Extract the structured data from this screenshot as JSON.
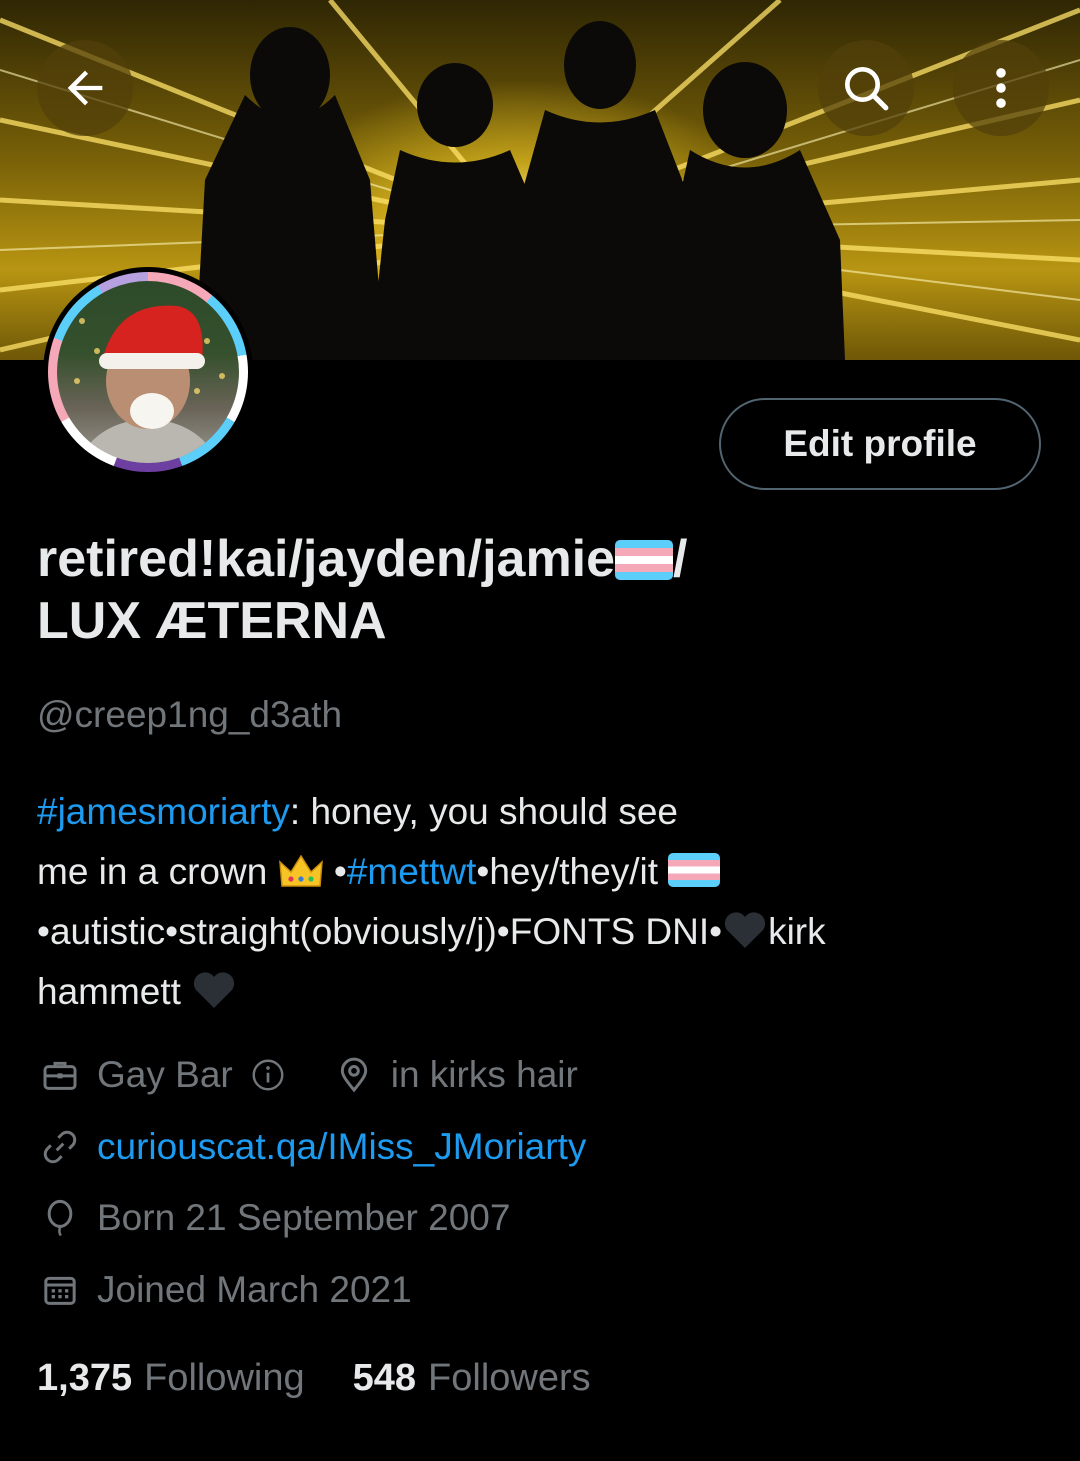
{
  "header": {
    "back_icon": "arrow-left-icon",
    "search_icon": "search-icon",
    "more_icon": "more-vertical-icon"
  },
  "profile": {
    "display_name_line1": "retired!kai/jayden/jamie",
    "display_name_flag": "transgender-flag-emoji",
    "display_name_suffix": "/",
    "display_name_line2": "LUX ÆTERNA",
    "handle": "@creep1ng_d3ath",
    "edit_button": "Edit profile"
  },
  "bio": {
    "hashtag1": "#jamesmoriarty",
    "text1": ": honey, you should see",
    "text2": "me in a crown ",
    "crown_emoji": "crown-emoji",
    "sep1": " •",
    "hashtag2": "#mettwt",
    "text3": "•hey/they/it ",
    "text4": "•autistic•straight(obviously/j)•FONTS DNI•",
    "heart_emoji": "black-heart-emoji",
    "text5": "kirk",
    "text6": "hammett "
  },
  "meta": {
    "profession": "Gay Bar",
    "profession_icon": "briefcase-icon",
    "info_icon": "info-icon",
    "location": "in kirks hair",
    "location_icon": "location-pin-icon",
    "url": "curiouscat.qa/IMiss_JMoriarty",
    "link_icon": "link-icon",
    "birthday": "Born 21 September 2007",
    "birthday_icon": "balloon-icon",
    "joined": "Joined March 2021",
    "joined_icon": "calendar-icon"
  },
  "stats": {
    "following_count": "1,375",
    "following_label": "Following",
    "followers_count": "548",
    "followers_label": "Followers"
  },
  "colors": {
    "background": "#000000",
    "text": "#e7e9ea",
    "secondary": "#71767b",
    "link": "#1d9bf0",
    "border": "#536471"
  }
}
